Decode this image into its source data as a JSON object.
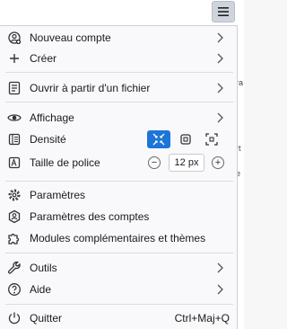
{
  "menu": {
    "items": [
      {
        "label": "Nouveau compte",
        "access": "N",
        "rest": "ouveau compte",
        "icon": "new-account-icon"
      },
      {
        "label": "Créer",
        "access": "C",
        "rest": "réer",
        "icon": "plus-icon"
      },
      {
        "label": "Ouvrir à partir d'un fichier",
        "icon": "open-file-icon"
      },
      {
        "label": "Affichage",
        "icon": "eye-icon"
      },
      {
        "label": "Densité",
        "icon": "density-icon"
      },
      {
        "label": "Taille de police",
        "icon": "font-size-icon",
        "value": "12 px"
      },
      {
        "label": "Paramètres",
        "icon": "gear-icon"
      },
      {
        "label": "Paramètres des comptes",
        "icon": "account-settings-icon"
      },
      {
        "label": "Modules complémentaires et thèmes",
        "icon": "puzzle-icon"
      },
      {
        "label": "Outils",
        "icon": "wrench-icon"
      },
      {
        "label": "Aide",
        "icon": "help-icon"
      },
      {
        "label": "Quitter",
        "icon": "power-icon",
        "shortcut": "Ctrl+Maj+Q"
      }
    ]
  },
  "font_size": {
    "minus": "−",
    "plus": "+"
  },
  "colors": {
    "accent": "#1d75d8"
  }
}
